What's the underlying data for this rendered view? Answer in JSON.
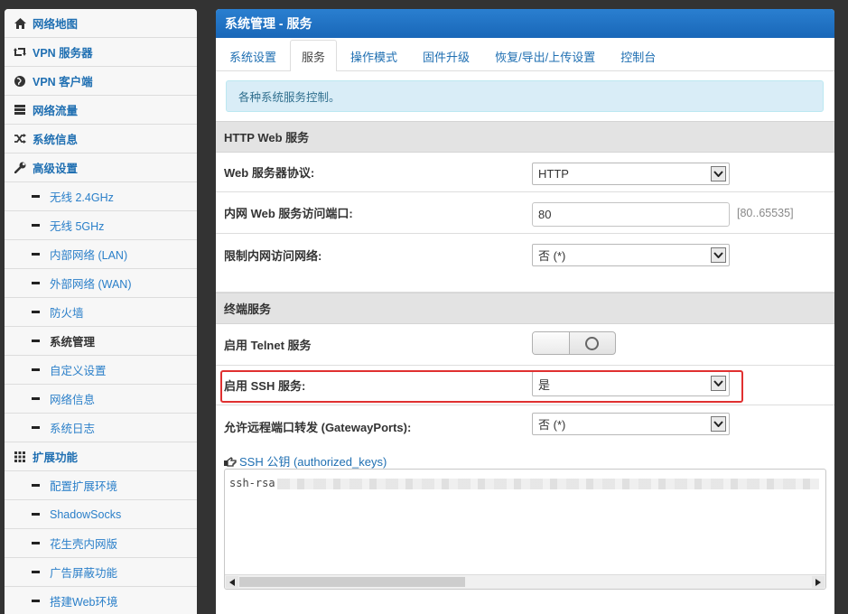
{
  "sidebar": {
    "items": [
      {
        "label": "网络地图",
        "icon": "home-icon"
      },
      {
        "label": "VPN 服务器",
        "icon": "retweet-icon"
      },
      {
        "label": "VPN 客户端",
        "icon": "globe-icon"
      },
      {
        "label": "网络流量",
        "icon": "hdd-icon"
      },
      {
        "label": "系统信息",
        "icon": "random-icon"
      },
      {
        "label": "高级设置",
        "icon": "wrench-icon"
      }
    ],
    "advanced": [
      {
        "label": "无线 2.4GHz"
      },
      {
        "label": "无线 5GHz"
      },
      {
        "label": "内部网络 (LAN)"
      },
      {
        "label": "外部网络 (WAN)"
      },
      {
        "label": "防火墙"
      },
      {
        "label": "系统管理"
      },
      {
        "label": "自定义设置"
      },
      {
        "label": "网络信息"
      },
      {
        "label": "系统日志"
      }
    ],
    "extensions": {
      "label": "扩展功能",
      "icon": "grid-icon"
    },
    "ext_items": [
      {
        "label": "配置扩展环境"
      },
      {
        "label": "ShadowSocks"
      },
      {
        "label": "花生壳内网版"
      },
      {
        "label": "广告屏蔽功能"
      },
      {
        "label": "搭建Web环境"
      }
    ],
    "active_item": "系统管理"
  },
  "panel": {
    "title": "系统管理 - 服务",
    "tabs": [
      {
        "label": "系统设置"
      },
      {
        "label": "服务"
      },
      {
        "label": "操作模式"
      },
      {
        "label": "固件升级"
      },
      {
        "label": "恢复/导出/上传设置"
      },
      {
        "label": "控制台"
      }
    ],
    "active_tab": "服务",
    "info": "各种系统服务控制。"
  },
  "http": {
    "heading": "HTTP Web 服务",
    "protocol_label": "Web 服务器协议:",
    "protocol_value": "HTTP",
    "port_label": "内网 Web 服务访问端口:",
    "port_value": "80",
    "port_hint": "[80..65535]",
    "restrict_label": "限制内网访问网络:",
    "restrict_value": "否 (*)"
  },
  "terminal": {
    "heading": "终端服务",
    "telnet_label": "启用 Telnet 服务",
    "telnet_state": "off",
    "ssh_label": "启用 SSH 服务:",
    "ssh_value": "是",
    "gateway_label": "允许远程端口转发 (GatewayPorts):",
    "gateway_value": "否 (*)",
    "keys_link": "SSH 公钥 (authorized_keys)",
    "keys_link_icon": "hand-pointer-icon",
    "keys_value": "ssh-rsa"
  },
  "colors": {
    "accent": "#1f6fb2",
    "header": "#1967b8",
    "highlight": "#e03030",
    "info_bg": "#d9edf7"
  }
}
